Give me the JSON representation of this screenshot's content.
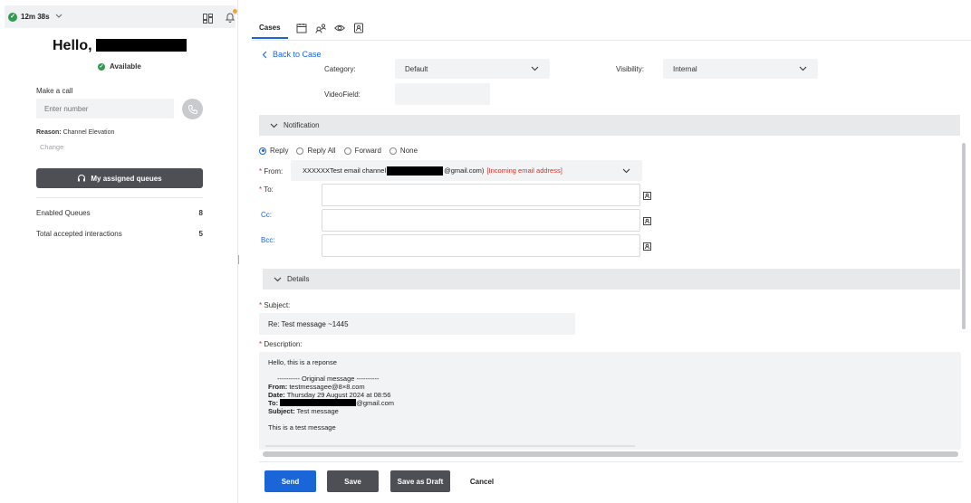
{
  "agent": {
    "timer": "12m 38s",
    "greeting": "Hello,",
    "status": "Available",
    "make_call_label": "Make a call",
    "number_placeholder": "Enter number",
    "reason_label": "Reason:",
    "reason_value": "Channel Elevation",
    "change_link": "Change",
    "queues_button": "My assigned queues",
    "stats": [
      {
        "label": "Enabled Queues",
        "value": "8"
      },
      {
        "label": "Total accepted interactions",
        "value": "5"
      }
    ]
  },
  "tabs": {
    "cases": "Cases"
  },
  "nav": {
    "back": "Back to Case"
  },
  "case_fields": {
    "category_label": "Category:",
    "category_value": "Default",
    "visibility_label": "Visibility:",
    "visibility_value": "Internal",
    "video_label": "VideoField:"
  },
  "notification": {
    "section_title": "Notification",
    "reply_options": [
      "Reply",
      "Reply All",
      "Forward",
      "None"
    ],
    "selected_option": "Reply",
    "from_label": "From:",
    "from_prefix": "XXXXXXTest email channel",
    "from_suffix": "@gmail.com)",
    "from_note": "[Incoming email address]",
    "to_label": "To:",
    "cc_label": "Cc:",
    "bcc_label": "Bcc:"
  },
  "details": {
    "section_title": "Details",
    "subject_label": "Subject:",
    "subject_value": "Re: Test message ~1445",
    "description_label": "Description:",
    "description": {
      "line1": "Hello, this is a reponse",
      "original_header": "---------- Original message ----------",
      "from_key": "From:",
      "from_val": "testmessagee@8×8.com",
      "date_key": "Date:",
      "date_val": "Thursday 29 August 2024 at 08:56",
      "to_key": "To:",
      "to_suffix": "@gmail.com",
      "subject_key": "Subject:",
      "subject_val": "Test message",
      "body": "This is a test message"
    }
  },
  "actions": {
    "send": "Send",
    "save": "Save",
    "save_draft": "Save as Draft",
    "cancel": "Cancel"
  },
  "colors": {
    "primary": "#1a66d8",
    "dark_button": "#4d4f54",
    "available_green": "#2e9c4f",
    "required_red": "#d93025",
    "notification_dot": "#f2a33a"
  }
}
